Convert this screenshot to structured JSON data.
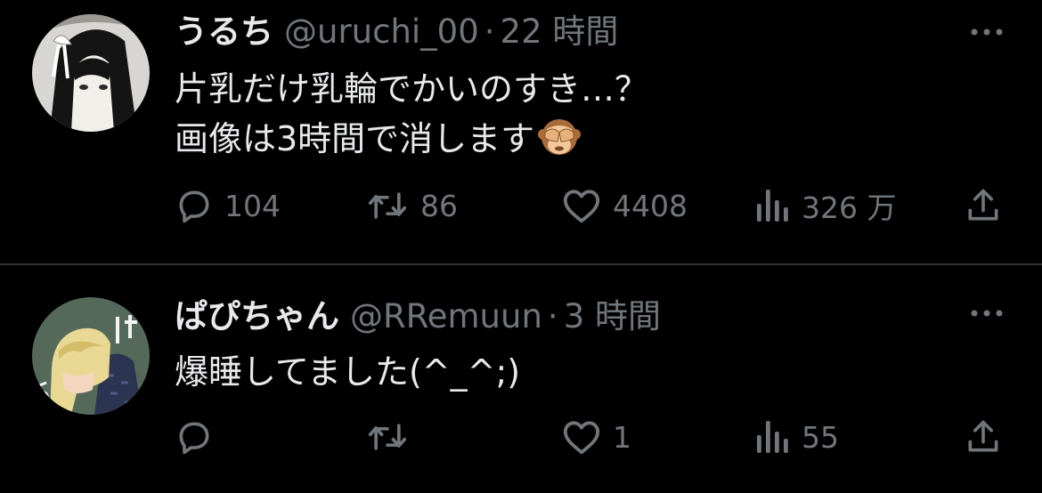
{
  "tweets": [
    {
      "display_name": "うるち",
      "handle": "@uruchi_00",
      "separator": "·",
      "time": "22 時間",
      "text_lines": [
        "片乳だけ乳輪でかいのすき…？",
        "画像は3時間で消します"
      ],
      "emoji": "see-no-evil-monkey",
      "avatar": "anime-girl-dark-hair-white-ribbon",
      "stats": {
        "replies": "104",
        "retweets": "86",
        "likes": "4408",
        "views": "326 万"
      }
    },
    {
      "display_name": "ぱぴちゃん",
      "handle": "@RRemuun",
      "separator": "·",
      "time": "3 時間",
      "text_lines": [
        "爆睡してました(^_^;)"
      ],
      "avatar": "anime-boy-blonde-hair-green-background",
      "stats": {
        "replies": "",
        "retweets": "",
        "likes": "1",
        "views": "55"
      }
    }
  ],
  "colors": {
    "background": "#000000",
    "primary_text": "#e7e9ea",
    "secondary_text": "#71767b",
    "divider": "#2f3336"
  },
  "icons": [
    "reply-icon",
    "retweet-icon",
    "like-icon",
    "views-icon",
    "share-icon",
    "more-icon"
  ]
}
